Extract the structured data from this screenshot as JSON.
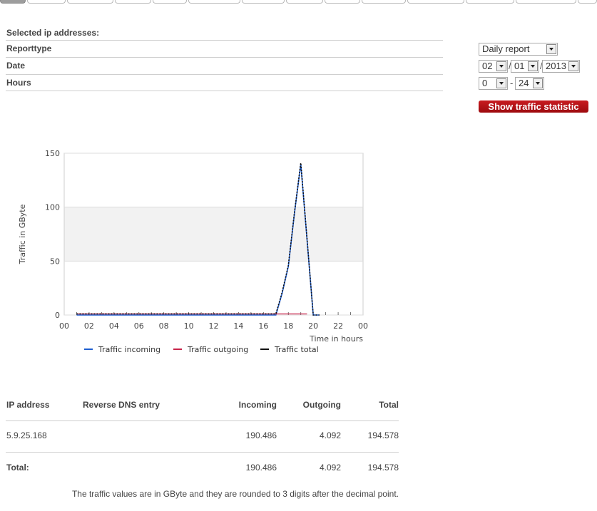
{
  "tabs": {
    "count": 14,
    "active_index": 0
  },
  "form": {
    "selected_ip_label": "Selected ip addresses:",
    "reporttype_label": "Reporttype",
    "date_label": "Date",
    "hours_label": "Hours",
    "reporttype_value": "Daily report",
    "day_value": "02",
    "month_value": "01",
    "year_value": "2013",
    "date_sep": "/",
    "hour_from": "0",
    "hour_to": "24",
    "hour_sep": "-",
    "submit_label": "Show traffic statistic"
  },
  "colors": {
    "accent_button": "#b70e13",
    "incoming": "#1f5fd0",
    "outgoing": "#c8234a",
    "total": "#111111"
  },
  "chart_data": {
    "type": "line",
    "ylabel": "Traffic in GByte",
    "xlabel": "Time in hours",
    "x_ticks": [
      "00",
      "02",
      "04",
      "06",
      "08",
      "10",
      "12",
      "14",
      "16",
      "18",
      "20",
      "22",
      "00"
    ],
    "y_ticks": [
      "0",
      "50",
      "100",
      "150"
    ],
    "ylim": [
      0,
      150
    ],
    "xlim": [
      0,
      24
    ],
    "grid": "banded",
    "legend_position": "bottom",
    "series": [
      {
        "name": "Traffic incoming",
        "x": [
          1,
          17,
          17.5,
          18,
          18.5,
          19,
          19.5,
          20,
          20.5
        ],
        "values": [
          0,
          0,
          20,
          45,
          95,
          140,
          70,
          0,
          0
        ]
      },
      {
        "name": "Traffic outgoing",
        "x": [
          1,
          17,
          19.5
        ],
        "values": [
          1,
          1,
          1
        ]
      },
      {
        "name": "Traffic total",
        "x": [
          1,
          17,
          17.5,
          18,
          18.5,
          19,
          19.5,
          20,
          20.5
        ],
        "values": [
          1,
          1,
          21,
          46,
          96,
          141,
          71,
          0,
          0
        ]
      }
    ]
  },
  "table": {
    "headers": {
      "ip": "IP address",
      "dns": "Reverse DNS entry",
      "incoming": "Incoming",
      "outgoing": "Outgoing",
      "total": "Total"
    },
    "rows": [
      {
        "ip": "5.9.25.168",
        "dns": "",
        "incoming": "190.486",
        "outgoing": "4.092",
        "total": "194.578"
      }
    ],
    "total_row": {
      "label": "Total:",
      "incoming": "190.486",
      "outgoing": "4.092",
      "total": "194.578"
    },
    "note": "The traffic values are in GByte and they are rounded to 3 digits after the decimal point."
  }
}
